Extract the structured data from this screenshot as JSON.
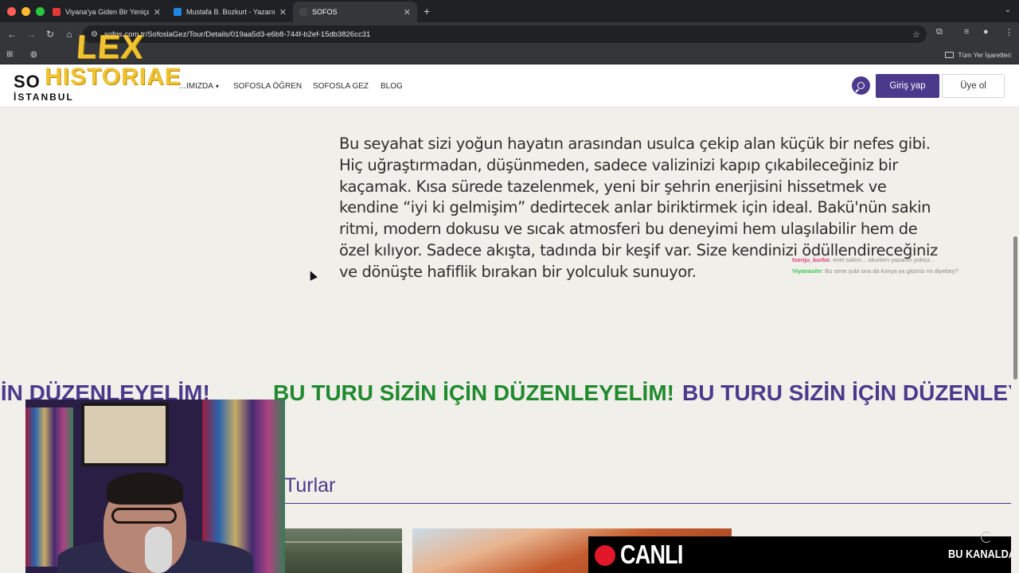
{
  "browser": {
    "tabs": [
      {
        "label": "Viyana'ya Giden Bir Yeniçeri",
        "favicon_color": "#e53935",
        "active": false
      },
      {
        "label": "Mustafa B. Bozkurt - Yazarın",
        "favicon_color": "#1e88e5",
        "active": false
      },
      {
        "label": "SOFOS",
        "favicon_color": "#444444",
        "active": true
      }
    ],
    "url": "sofos.com.tr/SofoslaGez/Tour/Details/019aa5d3-e6b8-744f-b2ef-15db3826cc31",
    "bookmarks_all_label": "Tüm Yer İşaretleri"
  },
  "site": {
    "logo_top": "SO",
    "logo_bottom": "İSTANBUL",
    "watermark_line1": "LEX",
    "watermark_line2": "HISTORIAE",
    "nav": [
      {
        "label": "…IMIZDA",
        "has_dropdown": true
      },
      {
        "label": "SOFOSLA ÖĞREN",
        "has_dropdown": false
      },
      {
        "label": "SOFOSLA GEZ",
        "has_dropdown": false
      },
      {
        "label": "BLOG",
        "has_dropdown": false
      }
    ],
    "login_label": "Giriş yap",
    "signup_label": "Üye ol"
  },
  "content": {
    "description": "Bu seyahat sizi yoğun hayatın arasından usulca çekip alan küçük bir nefes gibi. Hiç uğraştırmadan, düşünmeden, sadece valizinizi kapıp çıkabileceğiniz bir kaçamak. Kısa sürede tazelenmek, yeni bir şehrin enerjisini hissetmek ve kendine “iyi ki gelmişim” dedirtecek anlar biriktirmek için ideal. Bakü'nün sakin ritmi, modern dokusu ve sıcak atmosferi bu deneyimi hem ulaşılabilir hem de özel kılıyor. Sadece akışta, tadında bir keşif var. Size kendinizi ödüllendireceğiniz ve dönüşte hafiflik bırakan bir yolculuk sunuyor.",
    "marquee_segment_1": "ZİN İÇİN DÜZENLEYELİM!",
    "marquee_segment_2": "BU TURU SİZİN İÇİN DÜZENLEYELİM!",
    "marquee_segment_3": "BU TURU SİZİN İÇİN DÜZENLEYELİM!",
    "tours_title": "Turlar"
  },
  "overlay": {
    "chat": [
      {
        "user": "tsenju_kurbo",
        "message": ": evet sallım... okurken yazarım yoktur..."
      },
      {
        "user": "Viyanasitv",
        "message": ": Bu sene şubi ona da konya ya gitsiniz mi diyebey?"
      }
    ],
    "live_label": "CANLI",
    "live_right_label": "BU KANALDA"
  },
  "colors": {
    "brand_purple": "#4b3a8c",
    "marquee_green": "#1f8a2e",
    "live_red": "#e2182a",
    "watermark_yellow": "#f1c232"
  }
}
